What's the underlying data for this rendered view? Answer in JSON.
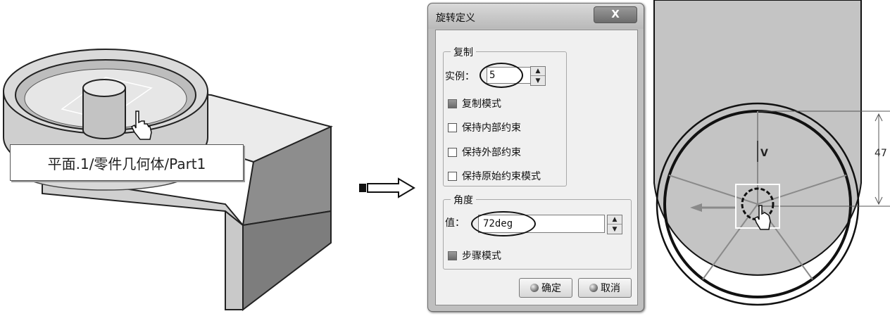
{
  "left_view": {
    "tooltip": "平面.1/零件几何体/Part1"
  },
  "dialog": {
    "title": "旋转定义",
    "close_label": "X",
    "copy_group": {
      "legend": "复制",
      "instances_label": "实例：",
      "instances_value": "5",
      "checkboxes": [
        {
          "label": "复制模式",
          "checked": true
        },
        {
          "label": "保持内部约束",
          "checked": false
        },
        {
          "label": "保持外部约束",
          "checked": false
        },
        {
          "label": "保持原始约束模式",
          "checked": false
        }
      ]
    },
    "angle_group": {
      "legend": "角度",
      "value_label": "值：",
      "value": "72deg",
      "step_mode_label": "步骤模式",
      "step_mode_checked": true
    },
    "ok_label": "确定",
    "cancel_label": "取消"
  },
  "right_view": {
    "dimension_text": "47",
    "axis_label": "V"
  }
}
